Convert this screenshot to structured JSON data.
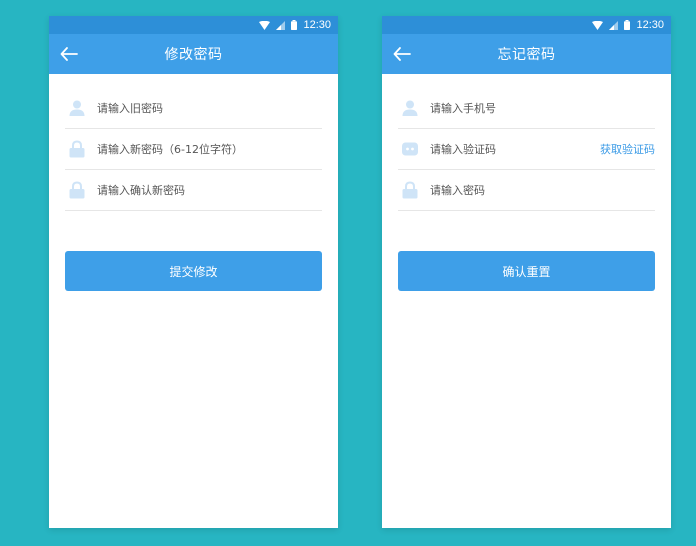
{
  "status_bar": {
    "time": "12:30"
  },
  "change_password": {
    "title": "修改密码",
    "fields": [
      {
        "placeholder": "请输入旧密码",
        "icon": "user-icon"
      },
      {
        "placeholder": "请输入新密码（6-12位字符）",
        "icon": "lock-icon"
      },
      {
        "placeholder": "请输入确认新密码",
        "icon": "lock-icon"
      }
    ],
    "submit_label": "提交修改"
  },
  "forgot_password": {
    "title": "忘记密码",
    "fields": [
      {
        "placeholder": "请输入手机号",
        "icon": "user-icon"
      },
      {
        "placeholder": "请输入验证码",
        "icon": "chat-bubble-icon"
      },
      {
        "placeholder": "请输入密码",
        "icon": "lock-icon"
      }
    ],
    "get_code_label": "获取验证码",
    "submit_label": "确认重置"
  },
  "colors": {
    "background": "#27b5c2",
    "status_bar": "#2d8fd8",
    "app_bar": "#3e9fe8",
    "button": "#3e9fe8",
    "link": "#3a9ae6",
    "icon": "#cfe4f7"
  }
}
